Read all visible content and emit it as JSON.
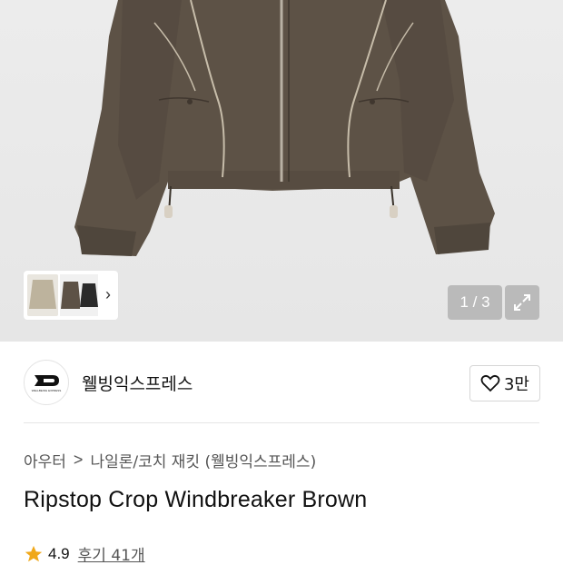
{
  "gallery": {
    "current": "1",
    "total": "3",
    "separator": " / "
  },
  "brand": {
    "name": "웰빙익스프레스",
    "logo_text": "WELLBEING EXPRESS",
    "like_count": "3만"
  },
  "breadcrumb": {
    "items": [
      "아우터",
      "나일론/코치 재킷 (웰빙익스프레스)"
    ],
    "separator": ">"
  },
  "product": {
    "title": "Ripstop Crop Windbreaker Brown",
    "rating": "4.9",
    "reviews_label": "후기 41개"
  },
  "colors": {
    "jacket": "#5d5246",
    "star": "#f0a81a",
    "hero_bg": "#e8e8e8"
  }
}
